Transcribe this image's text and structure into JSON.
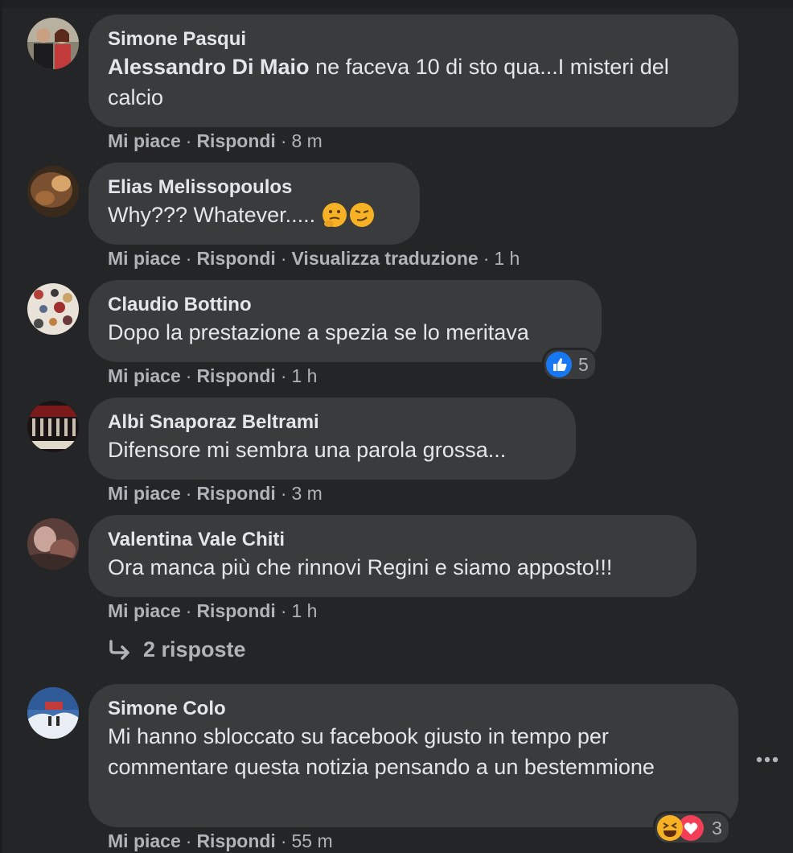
{
  "comments": [
    {
      "author": "Simone Pasqui",
      "mention": "Alessandro Di Maio",
      "text": " ne faceva 10 di sto qua...I misteri del calcio",
      "like": "Mi piace",
      "reply": "Rispondi",
      "time": "8 m"
    },
    {
      "author": "Elias Melissopoulos",
      "text": "Why??? Whatever.....",
      "like": "Mi piace",
      "reply": "Rispondi",
      "translate": "Visualizza traduzione",
      "time": "1 h"
    },
    {
      "author": "Claudio Bottino",
      "text": "Dopo la prestazione a spezia se lo meritava",
      "like": "Mi piace",
      "reply": "Rispondi",
      "time": "1 h",
      "reaction_count": "5"
    },
    {
      "author": "Albi Snaporaz Beltrami",
      "text": "Difensore mi sembra una parola grossa...",
      "like": "Mi piace",
      "reply": "Rispondi",
      "time": "3 m"
    },
    {
      "author": "Valentina Vale Chiti",
      "text": "Ora manca più che rinnovi Regini e siamo apposto!!!",
      "like": "Mi piace",
      "reply": "Rispondi",
      "time": "1 h"
    },
    {
      "author": "Simone Colo",
      "text": "Mi hanno sbloccato su facebook giusto in tempo per commentare questa notizia pensando a un bestemmione",
      "like": "Mi piace",
      "reply": "Rispondi",
      "time": "55 m",
      "reaction_count": "3"
    }
  ],
  "replies_link": "2 risposte",
  "more_icon": "more-horizontal-icon",
  "colors": {
    "background": "#242526",
    "bubble": "#3a3b3c",
    "text": "#e4e6eb",
    "muted": "#b0b3b8",
    "like_blue": "#1877f2",
    "love_red": "#f33e58",
    "haha_yellow": "#f7b125"
  }
}
